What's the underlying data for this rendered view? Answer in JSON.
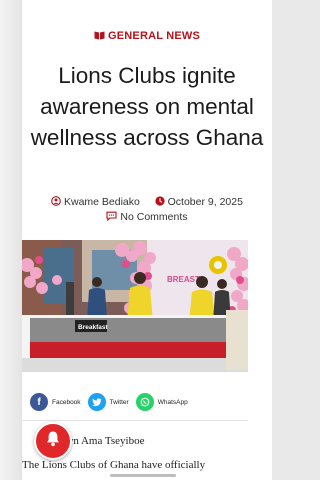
{
  "article": {
    "category": "GENERAL NEWS",
    "headline": "Lions Clubs ignite awareness on mental wellness across Ghana",
    "author": "Kwame Bediako",
    "date": "October 9, 2025",
    "comments": "No Comments"
  },
  "hero": {
    "banner_text": "BREAST",
    "desk_logo": "Breakfast"
  },
  "share": {
    "facebook": "Facebook",
    "twitter": "Twitter",
    "whatsapp": "WhatsApp"
  },
  "byline": "Joycelyn Ama Tseyiboe",
  "byline_visible": "oycelyn Ama Tseyiboe",
  "body_first_line": "The Lions Clubs of Ghana have officially",
  "icons": {
    "category": "book-open-icon",
    "author": "user-icon",
    "date": "clock-icon",
    "comments": "comment-icon",
    "notification": "bell-icon"
  },
  "colors": {
    "accent": "#b5121b",
    "facebook": "#3b5998",
    "twitter": "#1da1f2",
    "whatsapp": "#25d366",
    "notification": "#e0282b"
  }
}
